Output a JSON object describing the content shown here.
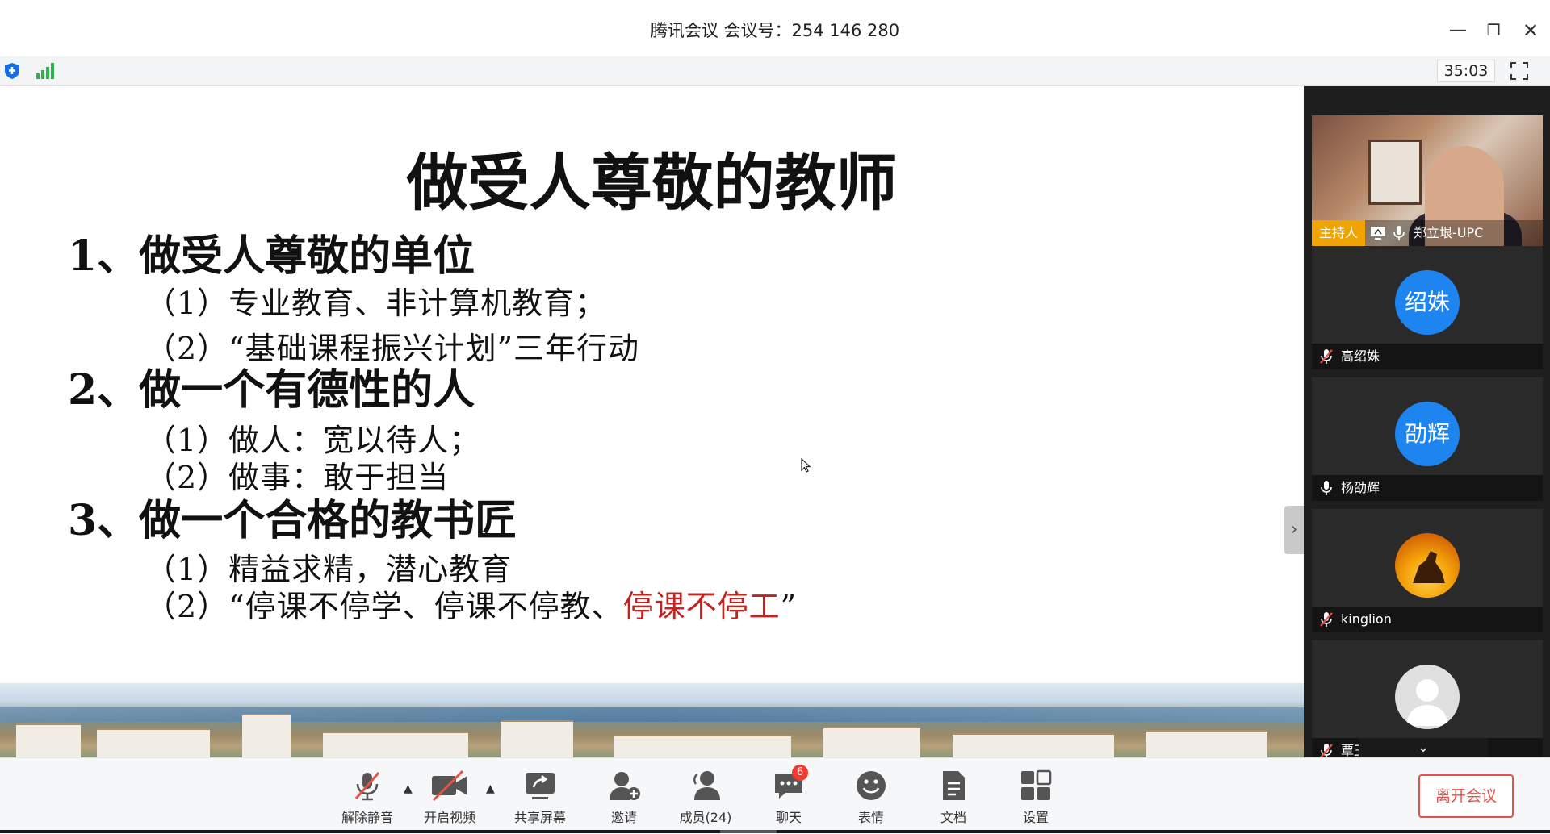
{
  "window": {
    "title": "腾讯会议 会议号：254 146 280",
    "minimize_icon": "minimize-icon",
    "restore_icon": "restore-icon",
    "close_icon": "close-icon"
  },
  "statusbar": {
    "timer": "35:03"
  },
  "slide": {
    "title": "做受人尊敬的教师",
    "sections": [
      {
        "heading": "1、做受人尊敬的单位",
        "items": [
          "（1）专业教育、非计算机教育；",
          "（2）“基础课程振兴计划”三年行动"
        ]
      },
      {
        "heading": "2、做一个有德性的人",
        "items": [
          "（1）做人：宽以待人；",
          "（2）做事：敢于担当"
        ]
      },
      {
        "heading": "3、做一个合格的教书匠",
        "items": [
          "（1）精益求精，潜心教育"
        ],
        "item_last_prefix": "（2）“停课不停学、停课不停教、",
        "item_last_red": "停课不停工",
        "item_last_suffix": "”"
      }
    ],
    "accent_red": "#c0241f"
  },
  "participants": {
    "host": {
      "badge": "主持人",
      "name": "郑立垠-UPC"
    },
    "list": [
      {
        "avatar_text": "绍姝",
        "name": "高绍姝",
        "muted": true
      },
      {
        "avatar_text": "劭辉",
        "name": "杨劭辉",
        "muted": false
      },
      {
        "avatar_text": "",
        "name": "kinglion",
        "muted": true
      },
      {
        "avatar_text": "",
        "name": "覃王康",
        "muted": true
      }
    ],
    "avatar_color": "#1e85f0"
  },
  "controls": {
    "unmute": "解除静音",
    "start_video": "开启视频",
    "share_screen": "共享屏幕",
    "invite": "邀请",
    "members": "成员(24)",
    "chat": "聊天",
    "chat_badge": "6",
    "reactions": "表情",
    "documents": "文档",
    "settings": "设置",
    "leave": "离开会议"
  }
}
